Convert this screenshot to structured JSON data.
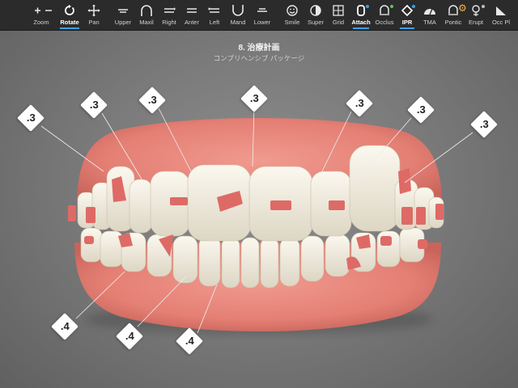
{
  "toolbar": {
    "items": [
      {
        "label": "Zoom",
        "icon": "zoom-icon"
      },
      {
        "label": "Rotate",
        "icon": "rotate-icon",
        "active": true
      },
      {
        "label": "Pan",
        "icon": "pan-icon"
      },
      {
        "label": "Upper",
        "icon": "upper-icon"
      },
      {
        "label": "Maxil",
        "icon": "maxil-icon"
      },
      {
        "label": "Right",
        "icon": "right-icon"
      },
      {
        "label": "Anter",
        "icon": "anter-icon"
      },
      {
        "label": "Left",
        "icon": "left-icon"
      },
      {
        "label": "Mand",
        "icon": "mand-icon"
      },
      {
        "label": "Lower",
        "icon": "lower-icon"
      },
      {
        "label": "Smile",
        "icon": "smile-icon"
      },
      {
        "label": "Super",
        "icon": "super-icon"
      },
      {
        "label": "Grid",
        "icon": "grid-icon"
      },
      {
        "label": "Attach",
        "icon": "attach-icon",
        "active": true
      },
      {
        "label": "Occlus",
        "icon": "occlus-icon"
      },
      {
        "label": "IPR",
        "icon": "ipr-icon",
        "active": true
      },
      {
        "label": "TMA",
        "icon": "tma-icon"
      },
      {
        "label": "Pontic",
        "icon": "pontic-icon"
      },
      {
        "label": "Erupt",
        "icon": "erupt-icon"
      },
      {
        "label": "Occ Pl",
        "icon": "occ-pl-icon"
      }
    ],
    "accent": "#3aa0e8",
    "dot_colors": {
      "attach": "#3aa0e8",
      "occlus": "#5cc45c",
      "ipr": "#3aa0e8"
    }
  },
  "header": {
    "title": "8. 治療計画",
    "subtitle": "コンプリヘンシブ パッケージ"
  },
  "ipr_labels": {
    "upper": [
      ".3",
      ".3",
      ".3",
      ".3",
      ".3",
      ".3",
      ".3"
    ],
    "lower": [
      ".4",
      ".4",
      ".4"
    ]
  },
  "colors": {
    "gum": "#e9867c",
    "tooth": "#f2ede1",
    "attachment": "#de6a66",
    "background": "#7b7b7b"
  }
}
